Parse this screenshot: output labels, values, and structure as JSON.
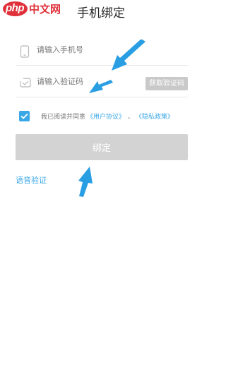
{
  "watermark": {
    "php": "php",
    "cn": "中文网"
  },
  "header": {
    "title": "手机绑定"
  },
  "phone_field": {
    "placeholder": "请输入手机号"
  },
  "code_field": {
    "placeholder": "请输入验证码",
    "get_code_label": "获取验证码"
  },
  "agreement": {
    "checked": true,
    "text": "我已阅读并同意",
    "user_agreement": "《用户协议》",
    "separator": "、",
    "privacy_policy": "《隐私政策》"
  },
  "bind_button": {
    "label": "绑定"
  },
  "voice_verify": {
    "label": "语音验证"
  },
  "colors": {
    "accent": "#3aa7e6",
    "disabled_button": "#d3d3d3",
    "arrow": "#2a9ee3"
  },
  "icons": [
    "phone-icon",
    "sms-code-icon",
    "checkmark-icon",
    "arrow-annotation-icon"
  ]
}
